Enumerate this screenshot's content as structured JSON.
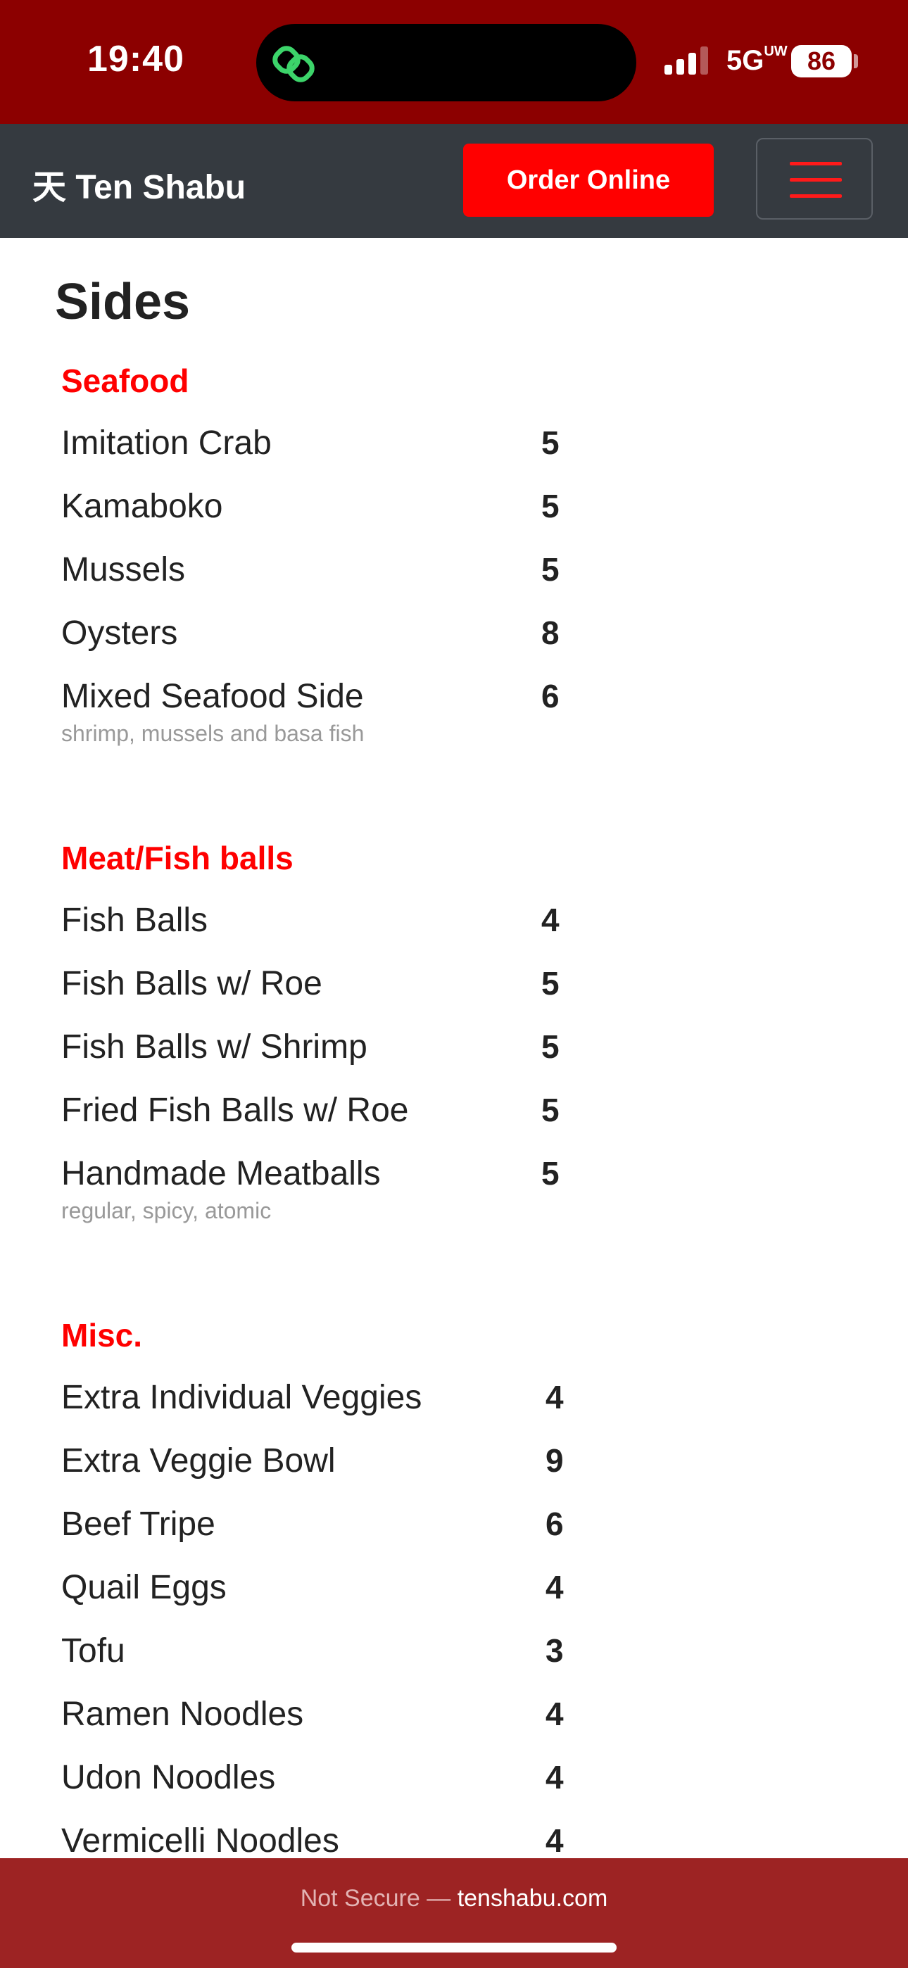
{
  "status_bar": {
    "time": "19:40",
    "network": "5G",
    "network_sub": "UW",
    "battery": "86",
    "signal_bars": 3,
    "island_icon": "link-icon"
  },
  "navbar": {
    "brand": "天 Ten Shabu",
    "order_button": "Order Online",
    "menu_icon": "hamburger-icon"
  },
  "page": {
    "title": "Sides"
  },
  "sections": [
    {
      "title": "Seafood",
      "items": [
        {
          "name": "Imitation Crab",
          "price": "5",
          "desc": ""
        },
        {
          "name": "Kamaboko",
          "price": "5",
          "desc": ""
        },
        {
          "name": "Mussels",
          "price": "5",
          "desc": ""
        },
        {
          "name": "Oysters",
          "price": "8",
          "desc": ""
        },
        {
          "name": "Mixed Seafood Side",
          "price": "6",
          "desc": "shrimp, mussels and basa fish"
        }
      ]
    },
    {
      "title": "Meat/Fish balls",
      "items": [
        {
          "name": "Fish Balls",
          "price": "4",
          "desc": ""
        },
        {
          "name": "Fish Balls w/ Roe",
          "price": "5",
          "desc": ""
        },
        {
          "name": "Fish Balls w/ Shrimp",
          "price": "5",
          "desc": ""
        },
        {
          "name": "Fried Fish Balls w/ Roe",
          "price": "5",
          "desc": ""
        },
        {
          "name": "Handmade Meatballs",
          "price": "5",
          "desc": "regular, spicy, atomic"
        }
      ]
    },
    {
      "title": "Misc.",
      "items": [
        {
          "name": "Extra Individual Veggies",
          "price": "4",
          "desc": ""
        },
        {
          "name": "Extra Veggie Bowl",
          "price": "9",
          "desc": ""
        },
        {
          "name": "Beef Tripe",
          "price": "6",
          "desc": ""
        },
        {
          "name": "Quail Eggs",
          "price": "4",
          "desc": ""
        },
        {
          "name": "Tofu",
          "price": "3",
          "desc": ""
        },
        {
          "name": "Ramen Noodles",
          "price": "4",
          "desc": ""
        },
        {
          "name": "Udon Noodles",
          "price": "4",
          "desc": ""
        },
        {
          "name": "Vermicelli Noodles",
          "price": "4",
          "desc": ""
        }
      ]
    }
  ],
  "browser_bar": {
    "prefix": "Not Secure — ",
    "domain": "tenshabu.com"
  },
  "colors": {
    "status_bg": "#8c0000",
    "nav_bg": "#353a40",
    "accent": "#ff0000",
    "bottom_bg": "#9d2323"
  }
}
